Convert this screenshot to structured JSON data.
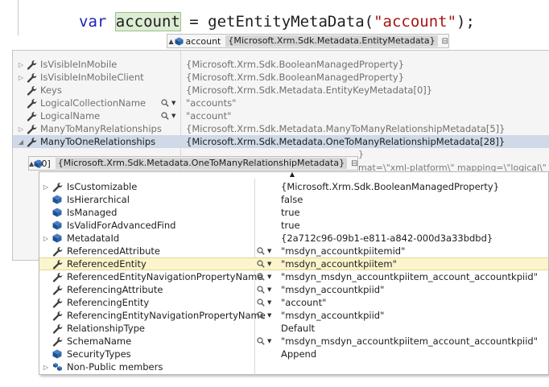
{
  "code": {
    "keyword": "var",
    "variable": "account",
    "assign": " = getEntityMetaData(",
    "string": "\"account\"",
    "end": ");"
  },
  "tooltip_header": {
    "name": "account",
    "value": "{Microsoft.Xrm.Sdk.Metadata.EntityMetadata}"
  },
  "outer_rows": [
    {
      "name": "IsVisibleInMobile",
      "value": "{Microsoft.Xrm.Sdk.BooleanManagedProperty}",
      "search": false,
      "expandable": true
    },
    {
      "name": "IsVisibleInMobileClient",
      "value": "{Microsoft.Xrm.Sdk.BooleanManagedProperty}",
      "search": false,
      "expandable": true
    },
    {
      "name": "Keys",
      "value": "{Microsoft.Xrm.Sdk.Metadata.EntityKeyMetadata[0]}",
      "search": false,
      "expandable": false
    },
    {
      "name": "LogicalCollectionName",
      "value": "\"accounts\"",
      "search": true,
      "expandable": false
    },
    {
      "name": "LogicalName",
      "value": "\"account\"",
      "search": true,
      "expandable": false
    },
    {
      "name": "ManyToManyRelationships",
      "value": "{Microsoft.Xrm.Sdk.Metadata.ManyToManyRelationshipMetadata[5]}",
      "search": false,
      "expandable": true
    },
    {
      "name": "ManyToOneRelationships",
      "value": "{Microsoft.Xrm.Sdk.Metadata.OneToManyRelationshipMetadata[28]}",
      "search": false,
      "expandable": true
    }
  ],
  "background_fragments": {
    "brace": "}",
    "xml": "mat=\\\"xml-platform\\\" mapping=\\\"logical\\\" d"
  },
  "tooltip_item": {
    "index": "[0]",
    "value": "{Microsoft.Xrm.Sdk.Metadata.OneToManyRelationshipMetadata}"
  },
  "inner_rows": [
    {
      "name": "IsCustomizable",
      "value": "{Microsoft.Xrm.Sdk.BooleanManagedProperty}",
      "icon": "wrench",
      "search": false,
      "expandable": true
    },
    {
      "name": "IsHierarchical",
      "value": "false",
      "icon": "cube",
      "search": false,
      "expandable": false
    },
    {
      "name": "IsManaged",
      "value": "true",
      "icon": "cube",
      "search": false,
      "expandable": false
    },
    {
      "name": "IsValidForAdvancedFind",
      "value": "true",
      "icon": "cube",
      "search": false,
      "expandable": false
    },
    {
      "name": "MetadataId",
      "value": "{2a712c96-09b1-e811-a842-000d3a33bdbd}",
      "icon": "cube",
      "search": false,
      "expandable": true
    },
    {
      "name": "ReferencedAttribute",
      "value": "\"msdyn_accountkpiitemid\"",
      "icon": "wrench",
      "search": true,
      "expandable": false
    },
    {
      "name": "ReferencedEntity",
      "value": "\"msdyn_accountkpiitem\"",
      "icon": "wrench",
      "search": true,
      "expandable": false
    },
    {
      "name": "ReferencedEntityNavigationPropertyName",
      "value": "\"msdyn_msdyn_accountkpiitem_account_accountkpiid\"",
      "icon": "wrench",
      "search": true,
      "expandable": false
    },
    {
      "name": "ReferencingAttribute",
      "value": "\"msdyn_accountkpiid\"",
      "icon": "wrench",
      "search": true,
      "expandable": false
    },
    {
      "name": "ReferencingEntity",
      "value": "\"account\"",
      "icon": "wrench",
      "search": true,
      "expandable": false
    },
    {
      "name": "ReferencingEntityNavigationPropertyName",
      "value": "\"msdyn_accountkpiid\"",
      "icon": "wrench",
      "search": true,
      "expandable": false
    },
    {
      "name": "RelationshipType",
      "value": "Default",
      "icon": "wrench",
      "search": false,
      "expandable": false
    },
    {
      "name": "SchemaName",
      "value": "\"msdyn_msdyn_accountkpiitem_account_accountkpiid\"",
      "icon": "wrench",
      "search": true,
      "expandable": false
    },
    {
      "name": "SecurityTypes",
      "value": "Append",
      "icon": "cube",
      "search": false,
      "expandable": false
    },
    {
      "name": "Non-Public members",
      "value": "",
      "icon": "group",
      "search": false,
      "expandable": true
    }
  ],
  "colors": {
    "keyword": "#1e22b8",
    "string": "#a31515",
    "selected_outer": "#cfd9e8",
    "selected_inner": "#fbf4cc"
  },
  "icons": {
    "wrench": "wrench-icon",
    "cube": "field-cube-icon",
    "group": "members-group-icon",
    "search": "magnifier-icon",
    "pin": "pin-icon"
  }
}
